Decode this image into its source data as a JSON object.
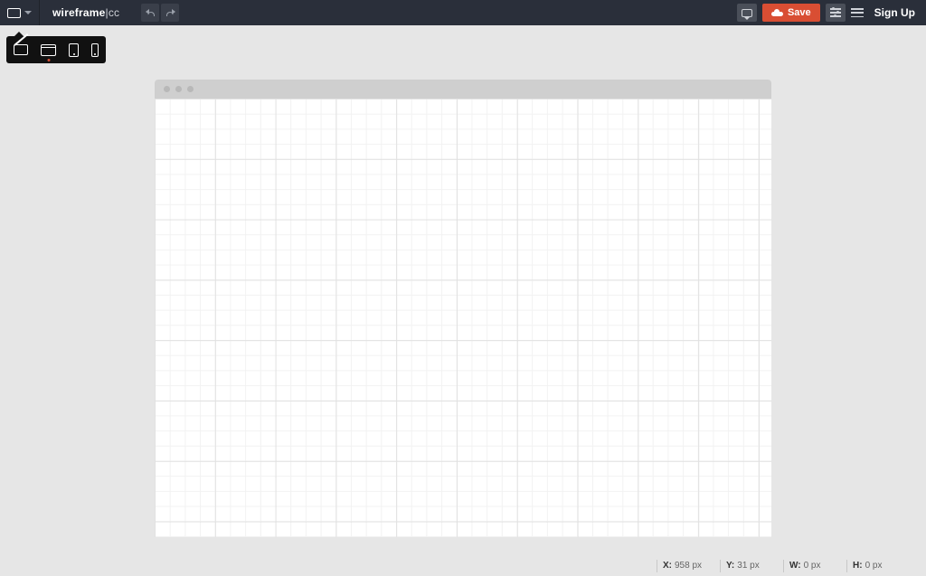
{
  "brand": {
    "name": "wireframe",
    "suffix": "cc"
  },
  "toolbar": {
    "save_label": "Save",
    "signup_label": "Sign Up"
  },
  "status": {
    "x_label": "X:",
    "x_value": "958 px",
    "y_label": "Y:",
    "y_value": "31 px",
    "w_label": "W:",
    "w_value": "0 px",
    "h_label": "H:",
    "h_value": "0 px"
  }
}
